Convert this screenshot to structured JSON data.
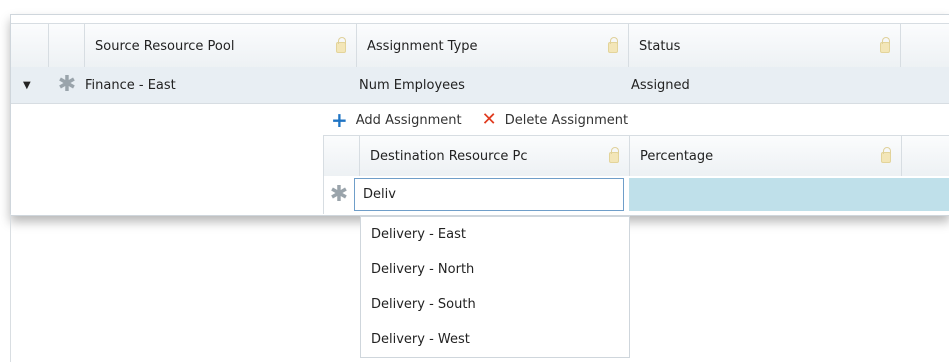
{
  "grid": {
    "columns": [
      {
        "label": "Source Resource Pool"
      },
      {
        "label": "Assignment Type"
      },
      {
        "label": "Status"
      }
    ],
    "row": {
      "source": "Finance - East",
      "assignment_type": "Num Employees",
      "status": "Assigned"
    }
  },
  "toolbar": {
    "add_label": "Add Assignment",
    "delete_label": "Delete Assignment"
  },
  "subgrid": {
    "columns": [
      {
        "label": "Destination Resource Pc"
      },
      {
        "label": "Percentage"
      }
    ],
    "input_value": "Deliv"
  },
  "dropdown": {
    "options": [
      "Delivery - East",
      "Delivery - North",
      "Delivery - South",
      "Delivery - West"
    ]
  },
  "colors": {
    "selected_row": "#e8eef3",
    "edit_cell": "#bfe0ea",
    "add_icon": "#1f74c4",
    "delete_icon": "#e03a1e"
  }
}
